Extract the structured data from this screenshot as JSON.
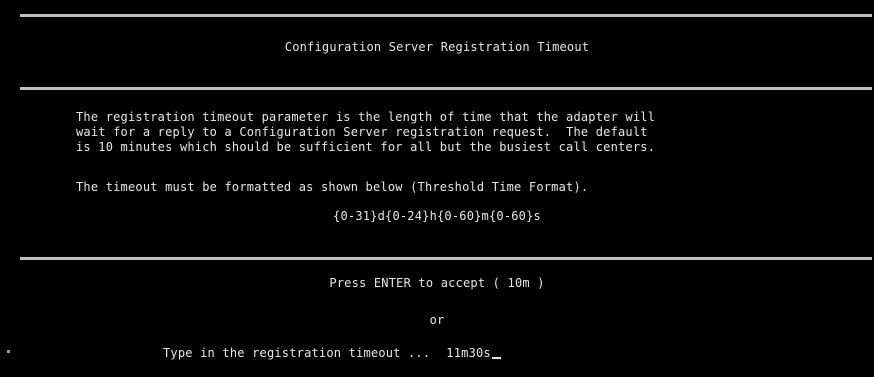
{
  "title": "Configuration Server Registration Timeout",
  "description_lines": [
    "The registration timeout parameter is the length of time that the adapter will",
    "wait for a reply to a Configuration Server registration request.  The default",
    "is 10 minutes which should be sufficient for all but the busiest call centers."
  ],
  "format_note": "The timeout must be formatted as shown below (Threshold Time Format).",
  "format_pattern": "{0-31}d{0-24}h{0-60}m{0-60}s",
  "accept_prompt": "Press ENTER to accept ( 10m )",
  "or_text": "or",
  "input_prompt": "Type in the registration timeout ...",
  "input_value": "11m30s"
}
